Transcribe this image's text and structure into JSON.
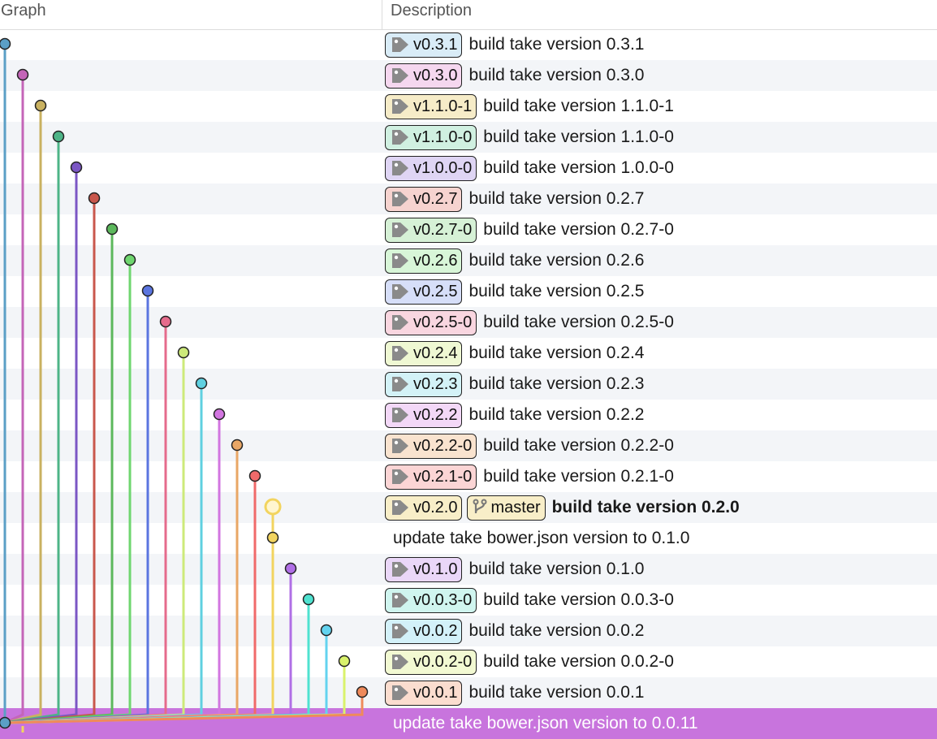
{
  "header": {
    "graph": "Graph",
    "description": "Description"
  },
  "commits": [
    {
      "tags": [
        "v0.3.1"
      ],
      "message": "build take version 0.3.1",
      "color": "#5b9fc6",
      "tagBg": "#d9ecf7"
    },
    {
      "tags": [
        "v0.3.0"
      ],
      "message": "build take version 0.3.0",
      "color": "#c465b8",
      "tagBg": "#f5d7ef"
    },
    {
      "tags": [
        "v1.1.0-1"
      ],
      "message": "build take version 1.1.0-1",
      "color": "#c9b160",
      "tagBg": "#f6ecc8"
    },
    {
      "tags": [
        "v1.1.0-0"
      ],
      "message": "build take version 1.1.0-0",
      "color": "#4db487",
      "tagBg": "#d0f0e1"
    },
    {
      "tags": [
        "v1.0.0-0"
      ],
      "message": "build take version 1.0.0-0",
      "color": "#7b56c4",
      "tagBg": "#dfd5f4"
    },
    {
      "tags": [
        "v0.2.7"
      ],
      "message": "build take version 0.2.7",
      "color": "#c9574c",
      "tagBg": "#f6d3cf"
    },
    {
      "tags": [
        "v0.2.7-0"
      ],
      "message": "build take version 0.2.7-0",
      "color": "#5cb85c",
      "tagBg": "#d6f1d6"
    },
    {
      "tags": [
        "v0.2.6"
      ],
      "message": "build take version 0.2.6",
      "color": "#6fd66f",
      "tagBg": "#d8f6d8"
    },
    {
      "tags": [
        "v0.2.5"
      ],
      "message": "build take version 0.2.5",
      "color": "#5b75e0",
      "tagBg": "#d6def8"
    },
    {
      "tags": [
        "v0.2.5-0"
      ],
      "message": "build take version 0.2.5-0",
      "color": "#e56b8c",
      "tagBg": "#f9d6e0"
    },
    {
      "tags": [
        "v0.2.4"
      ],
      "message": "build take version 0.2.4",
      "color": "#cdea7a",
      "tagBg": "#eff8d3"
    },
    {
      "tags": [
        "v0.2.3"
      ],
      "message": "build take version 0.2.3",
      "color": "#5fd0e0",
      "tagBg": "#d3f2f7"
    },
    {
      "tags": [
        "v0.2.2"
      ],
      "message": "build take version 0.2.2",
      "color": "#d276e0",
      "tagBg": "#f3d8f7"
    },
    {
      "tags": [
        "v0.2.2-0"
      ],
      "message": "build take version 0.2.2-0",
      "color": "#e9a766",
      "tagBg": "#f9e3cf"
    },
    {
      "tags": [
        "v0.2.1-0"
      ],
      "message": "build take version 0.2.1-0",
      "color": "#f06a6a",
      "tagBg": "#fbd5d5"
    },
    {
      "tags": [
        "v0.2.0"
      ],
      "branch": "master",
      "message": "build take version 0.2.0",
      "bold": true,
      "color": "#f2d45f",
      "tagBg": "#f8eec8"
    },
    {
      "tags": [],
      "message": "update take bower.json version to 0.1.0",
      "color": "#f2d45f",
      "tagBg": "#f8eec8"
    },
    {
      "tags": [
        "v0.1.0"
      ],
      "message": "build take version 0.1.0",
      "color": "#b06fe6",
      "tagBg": "#ead7f8"
    },
    {
      "tags": [
        "v0.0.3-0"
      ],
      "message": "build take version 0.0.3-0",
      "color": "#4fe2d0",
      "tagBg": "#d0f5ef"
    },
    {
      "tags": [
        "v0.0.2"
      ],
      "message": "build take version 0.0.2",
      "color": "#63d3ef",
      "tagBg": "#d3f1f9"
    },
    {
      "tags": [
        "v0.0.2-0"
      ],
      "message": "build take version 0.0.2-0",
      "color": "#d9f26b",
      "tagBg": "#f2f9d2"
    },
    {
      "tags": [
        "v0.0.1"
      ],
      "message": "build take version 0.0.1",
      "color": "#ef8a5b",
      "tagBg": "#fbddcf"
    },
    {
      "tags": [],
      "message": "update take bower.json version to 0.0.11",
      "selected": true,
      "color": "#5b9fc6",
      "tagBg": "#d9ecf7"
    }
  ],
  "icons": {
    "tag": "tag-icon",
    "branch": "git-branch-icon"
  }
}
